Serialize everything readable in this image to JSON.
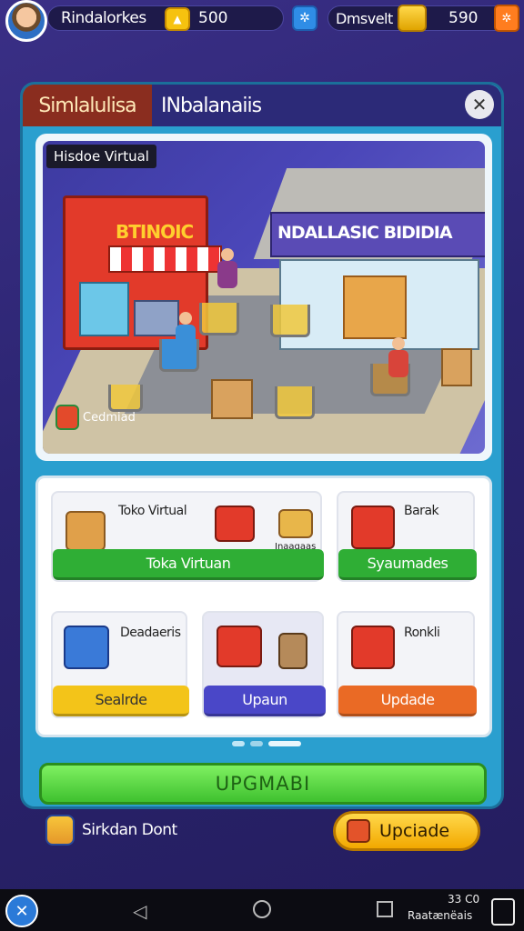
{
  "topbar": {
    "player_name": "Rindalorkes",
    "coins": "500",
    "right_name": "Dmsvelt",
    "gold": "590",
    "icons": [
      "avatar",
      "coin-icon",
      "blue-gear-icon",
      "gold-bar-icon",
      "orange-gear-icon"
    ]
  },
  "panel": {
    "tab_active": "Simlalulisa",
    "tab_inactive": "INbalanaiis",
    "close": "✕",
    "scene_label": "Hisdoe Virtual",
    "sign_left": "BTINOIC",
    "sign_right": "NDALLASIC BIDIDIA",
    "scene_badge": "Cedmiad"
  },
  "cards": [
    {
      "label": "Toko Virtual",
      "sub": "Inaagaas",
      "button": "Toka Virtuan",
      "color": "#2fae35"
    },
    {
      "label": "Barak",
      "sub": "",
      "button": "Syaumades",
      "color": "#2fae35"
    },
    {
      "label": "Deadaeris",
      "sub": "",
      "button": "Sealrde",
      "color": "#f3c419"
    },
    {
      "label": "",
      "sub": "",
      "button": "Upaun",
      "color": "#4a47c8"
    },
    {
      "label": "Ronkli",
      "sub": "",
      "button": "Updade",
      "color": "#ea6a25"
    }
  ],
  "big_button": "UPGMABI",
  "bottom": {
    "left_text": "Sirkdan Dont",
    "update_button": "Upciade"
  },
  "navbar": {
    "time": "33 C0",
    "status": "Raatænëais"
  }
}
